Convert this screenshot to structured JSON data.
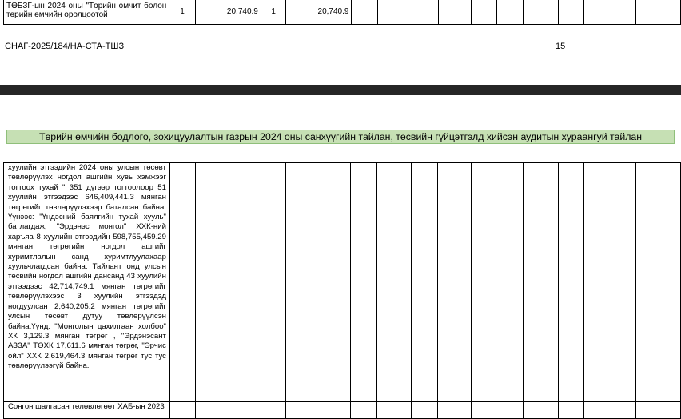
{
  "top_row": {
    "text": "ТӨБЗГ-ын 2024 оны \"Төрийн өмчит болон төрийн өмчийн оролцоотой",
    "col1": "1",
    "col2": "20,740.9",
    "col3": "1",
    "col4": "20,740.9"
  },
  "footer": {
    "doc_code": "СНАГ-2025/184/НА-СТА-ТШЗ",
    "page_number": "15"
  },
  "section_title": "Төрийн өмчийн бодлого, зохицуулалтын газрын 2024 оны санхүүгийн тайлан, төсвийн гүйцэтгэлд хийсэн аудитын хураангуй тайлан",
  "main_row": {
    "text": "хуулийн этгээдийн 2024 оны улсын төсөвт төвлөрүүлэх ногдол ашгийн хувь хэмжээг тогтоох тухай \" 351 дүгээр тогтоолоор 51 хуулийн этгээдээс 646,409,441.3 мянган төгрөгийг төвлөрүүлэхээр баталсан байна. Үүнээс: \"Үндэсний баялгийн тухай хууль\" батлагдаж, \"Эрдэнэс монгол\" ХХК-ний харъяа 8 хуулийн этгээдийн 598,755,459.29 мянган төгрөгийн ногдол ашгийг хуримтлалын санд хуримтлуулахаар хуульчлагдсан байна. Тайлант онд улсын төсвийн ногдол ашгийн дансанд 43 хуулийн этгээдээс 42,714,749.1 мянган төгрөгийг төвлөрүүлэхээс 3 хуулийн этгээдэд ногдуулсан 2,640,205.2 мянган төгрөгийг улсын төсөвт дутуу төвлөрүүлсэн байна.Үүнд: \"Монголын цахилгаан холбоо\" ХК 3,129.3 мянган төгрөг , \"Эрдэнэсант АЗЗА\" ТӨХК 17,611.6 мянган төгрөг, \"Эрчис ойл\" ХХК 2,619,464.3 мянган төгрөг тус тус төвлөрүүлээгүй байна."
  },
  "next_row_text": "Сонгон шалгасан төлөвлөгөөт ХАБ-ын 2023"
}
